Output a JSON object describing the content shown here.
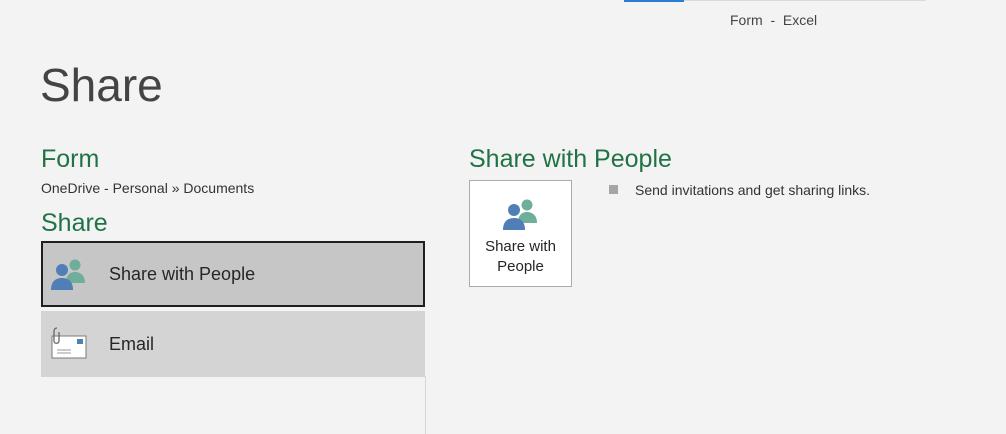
{
  "window": {
    "title": "Form  -  Excel"
  },
  "backstage": {
    "page_title": "Share",
    "document": {
      "name": "Form",
      "location": "OneDrive - Personal » Documents"
    },
    "section_heading": "Share",
    "options": [
      {
        "label": "Share with People",
        "icon": "people-icon",
        "selected": true
      },
      {
        "label": "Email",
        "icon": "email-icon",
        "selected": false
      }
    ]
  },
  "panel": {
    "heading": "Share with People",
    "button_label_line1": "Share with",
    "button_label_line2": "People",
    "description": "Send invitations and get sharing links."
  },
  "colors": {
    "accent_green": "#217346",
    "background": "#f3f3f3",
    "selected_option": "#c6c6c6",
    "option_background": "#d4d4d4"
  }
}
